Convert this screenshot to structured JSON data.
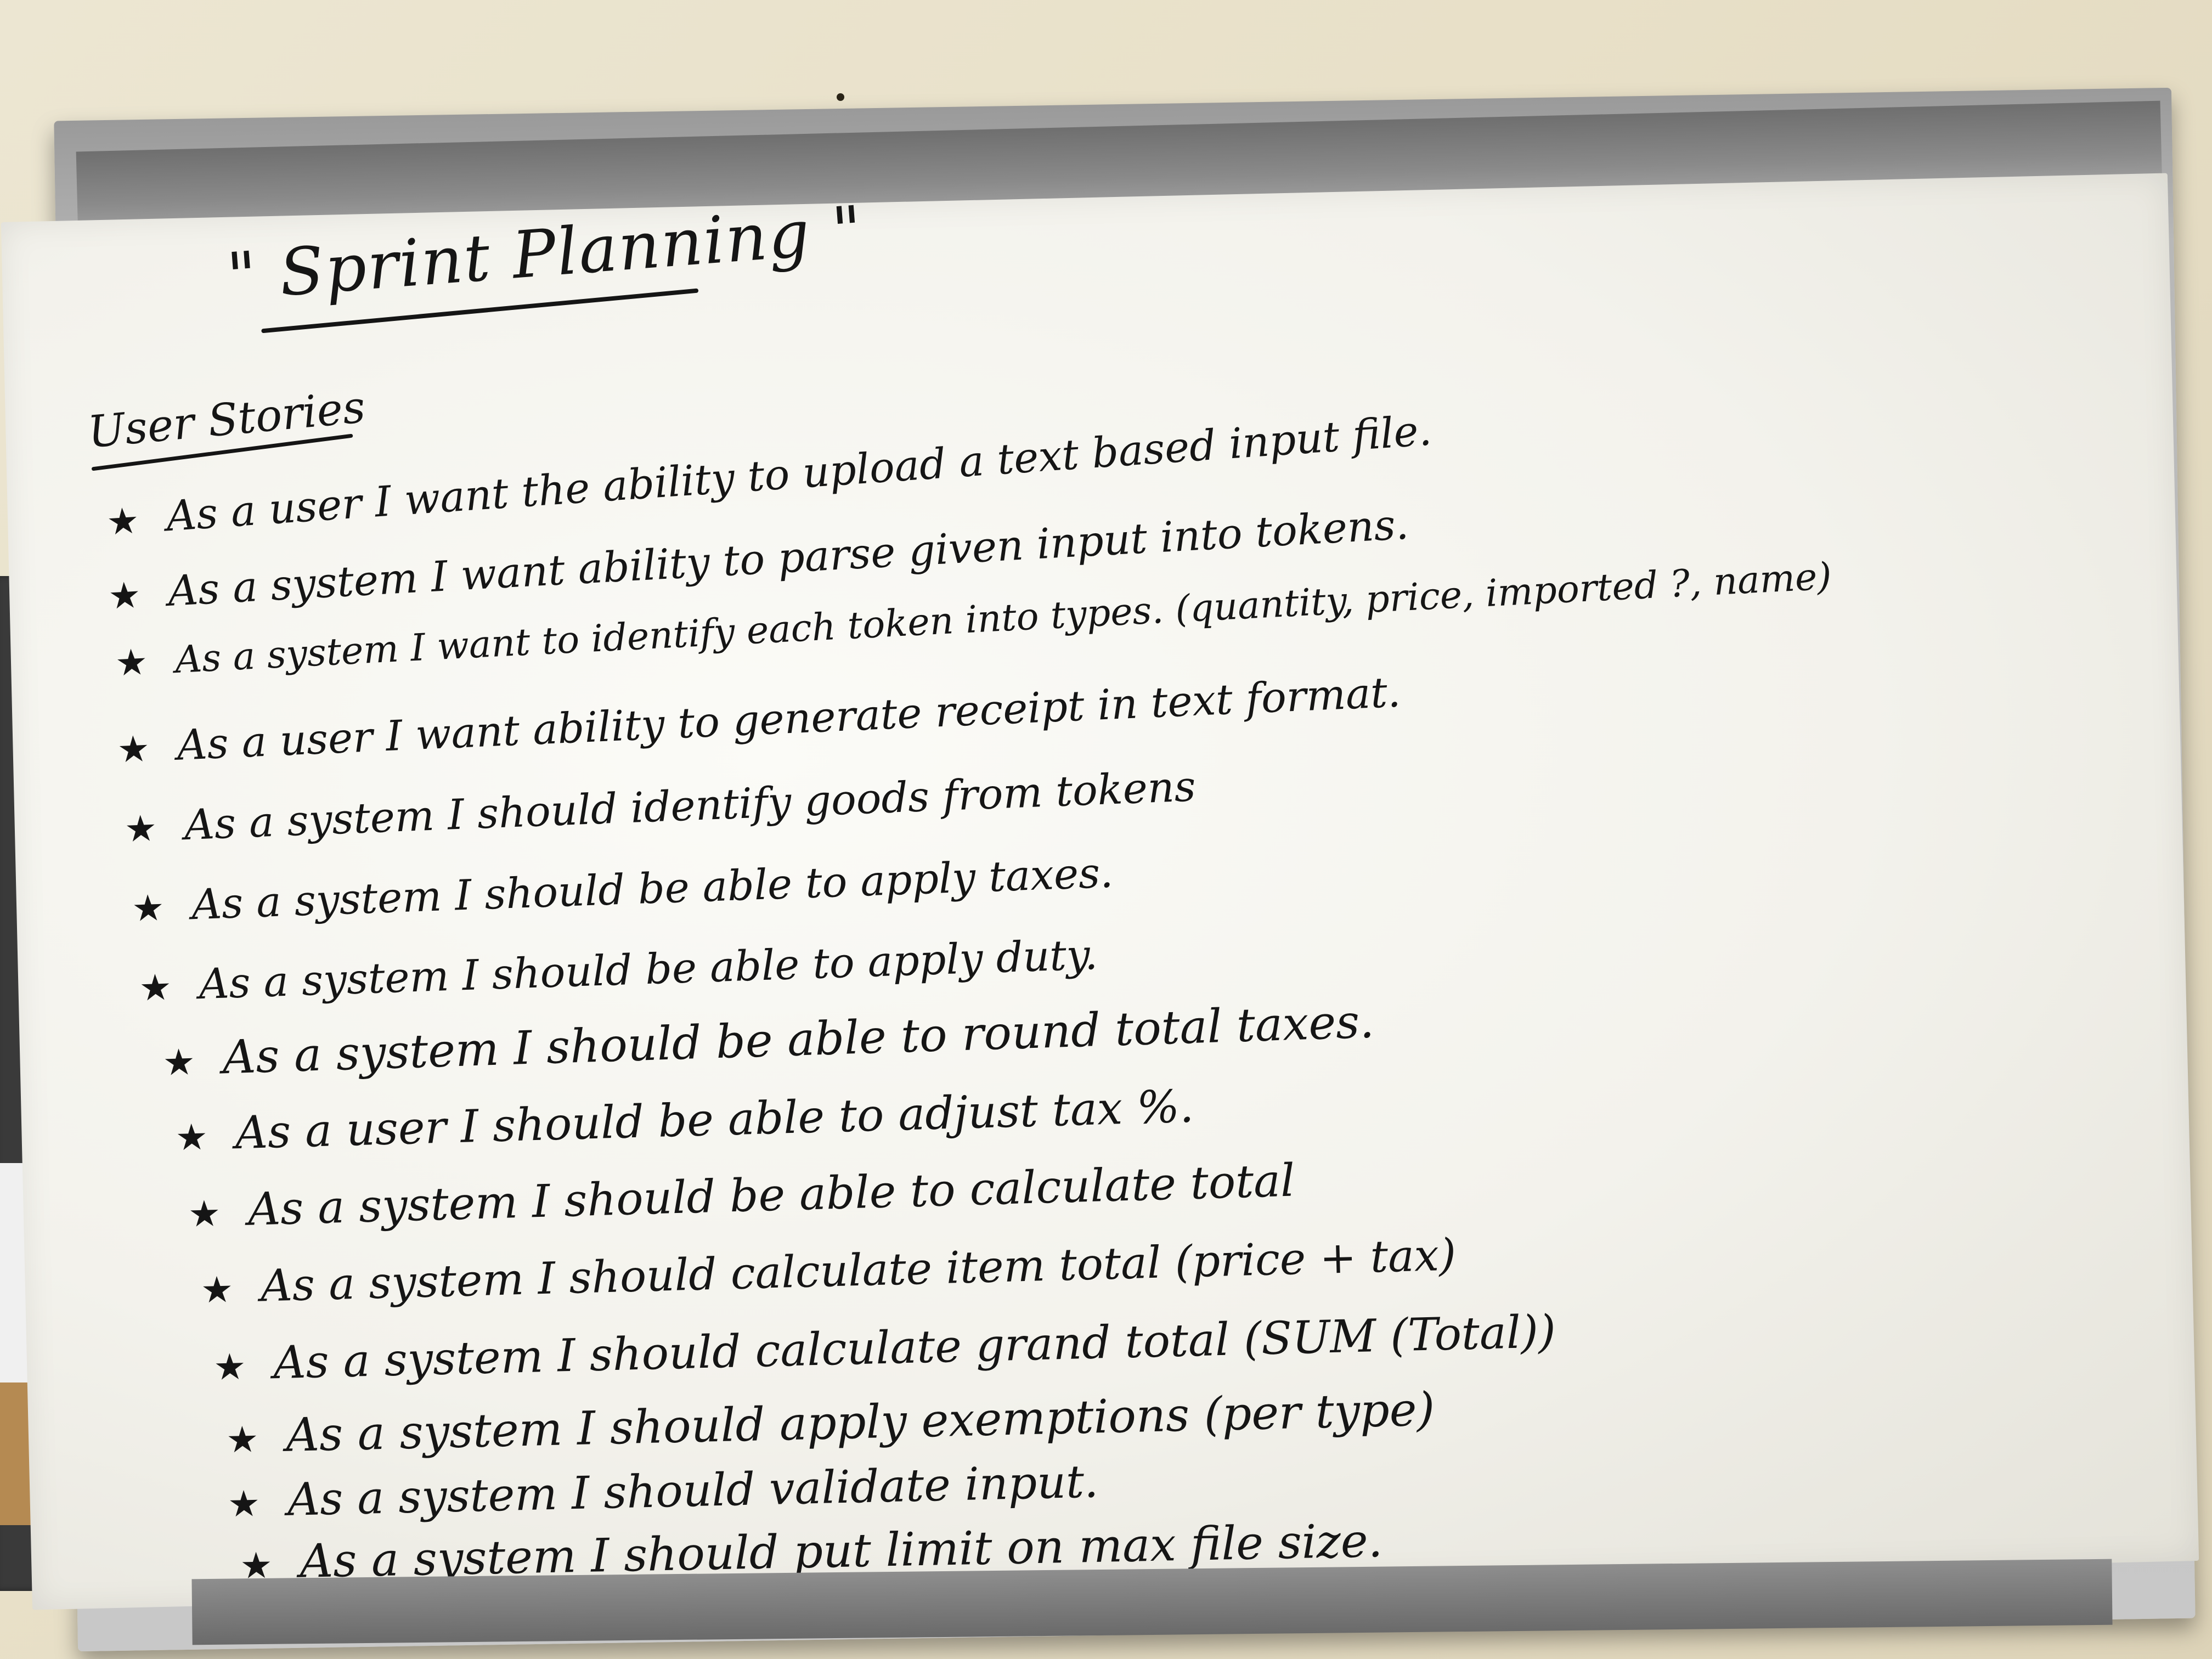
{
  "whiteboard": {
    "title": "\" Sprint Planning \"",
    "section_heading": "User Stories",
    "bullet_glyph": "★",
    "stories": [
      "As a user I want the ability to upload a text based input file.",
      "As a system I want ability to parse given input into tokens.",
      "As a system I want to identify each token into types. (quantity, price, imported ?, name)",
      "As a user I want ability to generate receipt in text format.",
      "As a system I should identify goods from tokens",
      "As a system I should be able to apply taxes.",
      "As a system I should be able to apply duty.",
      "As a system I should be able to round total taxes.",
      "As a user I should be able to adjust tax %.",
      "As a system I should be able to calculate total",
      "As a system I should calculate item total (price + tax)",
      "As a system I should calculate grand total (SUM (Total))",
      "As a system I should apply exemptions (per type)",
      "As a system I should validate input.",
      "As a system I should put limit on max file size."
    ]
  }
}
